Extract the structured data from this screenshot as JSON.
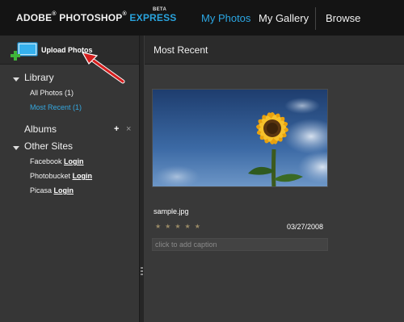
{
  "header": {
    "brand_adobe": "ADOBE",
    "brand_photoshop": "PHOTOSHOP",
    "brand_reg": "®",
    "brand_express": "EXPRESS",
    "beta": "BETA",
    "nav": {
      "my_photos": "My Photos",
      "my_gallery": "My Gallery",
      "browse": "Browse"
    }
  },
  "sidebar": {
    "upload_label": "Upload Photos",
    "library": {
      "title": "Library",
      "items": [
        {
          "label": "All Photos (1)"
        },
        {
          "label": "Most Recent (1)"
        }
      ]
    },
    "albums": {
      "title": "Albums",
      "add": "+",
      "remove": "×"
    },
    "other_sites": {
      "title": "Other Sites",
      "items": [
        {
          "site": "Facebook",
          "action": "Login"
        },
        {
          "site": "Photobucket",
          "action": "Login"
        },
        {
          "site": "Picasa",
          "action": "Login"
        }
      ]
    }
  },
  "main": {
    "title": "Most Recent",
    "photo": {
      "filename": "sample.jpg",
      "rating_stars": "★★★★★",
      "rating": 0,
      "date": "03/27/2008",
      "caption_placeholder": "click to add caption"
    }
  },
  "colors": {
    "accent_blue": "#29a3dd",
    "topbar_bg": "#141414",
    "sidebar_bg": "#363636",
    "main_bg": "#393939",
    "annotation_red": "#d61f1f"
  }
}
